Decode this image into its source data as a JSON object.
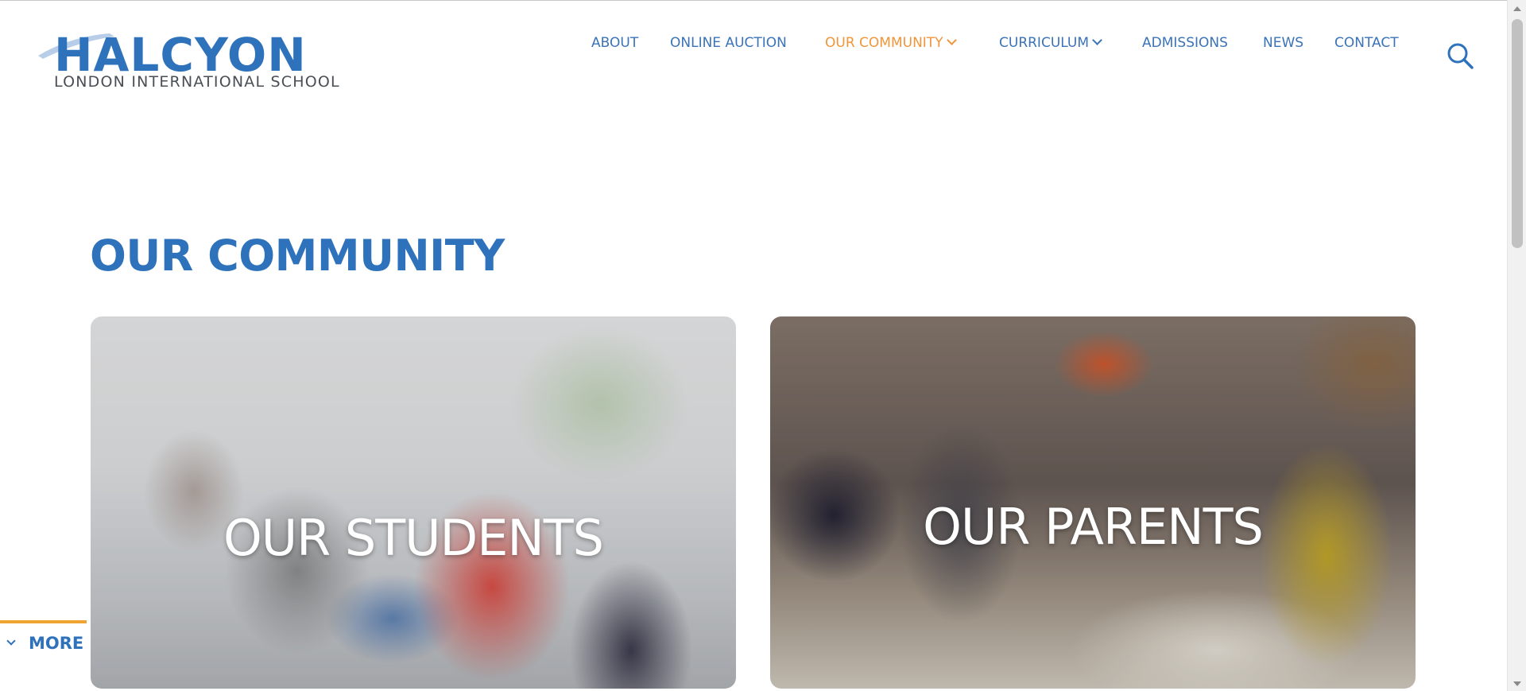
{
  "header": {
    "logo": {
      "wordmark": "HALCYON",
      "subtitle": "LONDON INTERNATIONAL SCHOOL",
      "colors": {
        "blue": "#2f72bc",
        "gray": "#4a4f55"
      }
    },
    "nav": [
      {
        "label": "ABOUT",
        "active": false,
        "has_dropdown": false
      },
      {
        "label": "ONLINE AUCTION",
        "active": false,
        "has_dropdown": false
      },
      {
        "label": "OUR COMMUNITY",
        "active": true,
        "has_dropdown": true
      },
      {
        "label": "CURRICULUM",
        "active": false,
        "has_dropdown": true
      },
      {
        "label": "ADMISSIONS",
        "active": false,
        "has_dropdown": false
      },
      {
        "label": "NEWS",
        "active": false,
        "has_dropdown": false
      },
      {
        "label": "CONTACT",
        "active": false,
        "has_dropdown": false
      }
    ],
    "search_icon": "search-icon"
  },
  "main": {
    "title": "OUR COMMUNITY",
    "cards": [
      {
        "label": "OUR STUDENTS",
        "image": "students-photo"
      },
      {
        "label": "OUR PARENTS",
        "image": "parents-photo"
      }
    ]
  },
  "more_tab": {
    "label": "MORE",
    "icon": "chevron-down-icon"
  },
  "colors": {
    "brand_blue": "#2f72bc",
    "nav_blue": "#3a73b7",
    "active_orange": "#f0953a",
    "more_accent": "#f0a431"
  }
}
